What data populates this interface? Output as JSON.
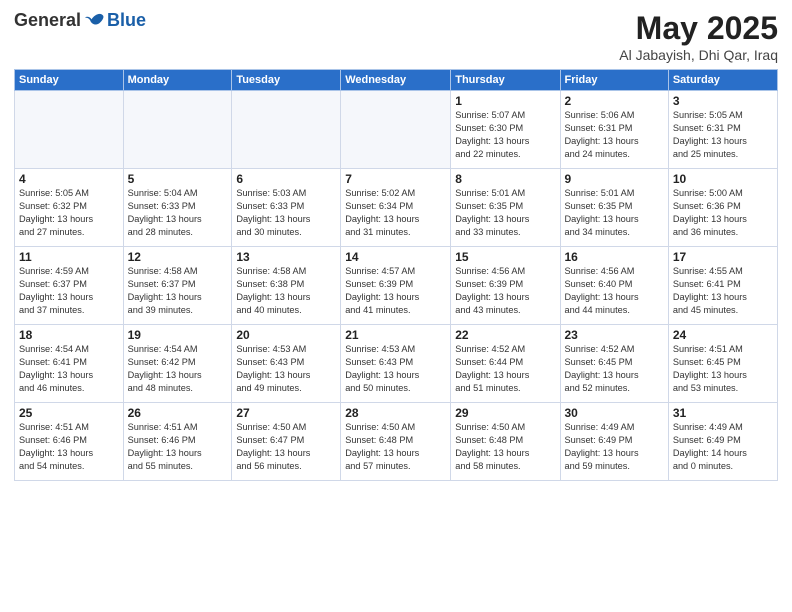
{
  "header": {
    "logo_general": "General",
    "logo_blue": "Blue",
    "month_title": "May 2025",
    "location": "Al Jabayish, Dhi Qar, Iraq"
  },
  "days_of_week": [
    "Sunday",
    "Monday",
    "Tuesday",
    "Wednesday",
    "Thursday",
    "Friday",
    "Saturday"
  ],
  "weeks": [
    [
      {
        "day": "",
        "info": ""
      },
      {
        "day": "",
        "info": ""
      },
      {
        "day": "",
        "info": ""
      },
      {
        "day": "",
        "info": ""
      },
      {
        "day": "1",
        "info": "Sunrise: 5:07 AM\nSunset: 6:30 PM\nDaylight: 13 hours\nand 22 minutes."
      },
      {
        "day": "2",
        "info": "Sunrise: 5:06 AM\nSunset: 6:31 PM\nDaylight: 13 hours\nand 24 minutes."
      },
      {
        "day": "3",
        "info": "Sunrise: 5:05 AM\nSunset: 6:31 PM\nDaylight: 13 hours\nand 25 minutes."
      }
    ],
    [
      {
        "day": "4",
        "info": "Sunrise: 5:05 AM\nSunset: 6:32 PM\nDaylight: 13 hours\nand 27 minutes."
      },
      {
        "day": "5",
        "info": "Sunrise: 5:04 AM\nSunset: 6:33 PM\nDaylight: 13 hours\nand 28 minutes."
      },
      {
        "day": "6",
        "info": "Sunrise: 5:03 AM\nSunset: 6:33 PM\nDaylight: 13 hours\nand 30 minutes."
      },
      {
        "day": "7",
        "info": "Sunrise: 5:02 AM\nSunset: 6:34 PM\nDaylight: 13 hours\nand 31 minutes."
      },
      {
        "day": "8",
        "info": "Sunrise: 5:01 AM\nSunset: 6:35 PM\nDaylight: 13 hours\nand 33 minutes."
      },
      {
        "day": "9",
        "info": "Sunrise: 5:01 AM\nSunset: 6:35 PM\nDaylight: 13 hours\nand 34 minutes."
      },
      {
        "day": "10",
        "info": "Sunrise: 5:00 AM\nSunset: 6:36 PM\nDaylight: 13 hours\nand 36 minutes."
      }
    ],
    [
      {
        "day": "11",
        "info": "Sunrise: 4:59 AM\nSunset: 6:37 PM\nDaylight: 13 hours\nand 37 minutes."
      },
      {
        "day": "12",
        "info": "Sunrise: 4:58 AM\nSunset: 6:37 PM\nDaylight: 13 hours\nand 39 minutes."
      },
      {
        "day": "13",
        "info": "Sunrise: 4:58 AM\nSunset: 6:38 PM\nDaylight: 13 hours\nand 40 minutes."
      },
      {
        "day": "14",
        "info": "Sunrise: 4:57 AM\nSunset: 6:39 PM\nDaylight: 13 hours\nand 41 minutes."
      },
      {
        "day": "15",
        "info": "Sunrise: 4:56 AM\nSunset: 6:39 PM\nDaylight: 13 hours\nand 43 minutes."
      },
      {
        "day": "16",
        "info": "Sunrise: 4:56 AM\nSunset: 6:40 PM\nDaylight: 13 hours\nand 44 minutes."
      },
      {
        "day": "17",
        "info": "Sunrise: 4:55 AM\nSunset: 6:41 PM\nDaylight: 13 hours\nand 45 minutes."
      }
    ],
    [
      {
        "day": "18",
        "info": "Sunrise: 4:54 AM\nSunset: 6:41 PM\nDaylight: 13 hours\nand 46 minutes."
      },
      {
        "day": "19",
        "info": "Sunrise: 4:54 AM\nSunset: 6:42 PM\nDaylight: 13 hours\nand 48 minutes."
      },
      {
        "day": "20",
        "info": "Sunrise: 4:53 AM\nSunset: 6:43 PM\nDaylight: 13 hours\nand 49 minutes."
      },
      {
        "day": "21",
        "info": "Sunrise: 4:53 AM\nSunset: 6:43 PM\nDaylight: 13 hours\nand 50 minutes."
      },
      {
        "day": "22",
        "info": "Sunrise: 4:52 AM\nSunset: 6:44 PM\nDaylight: 13 hours\nand 51 minutes."
      },
      {
        "day": "23",
        "info": "Sunrise: 4:52 AM\nSunset: 6:45 PM\nDaylight: 13 hours\nand 52 minutes."
      },
      {
        "day": "24",
        "info": "Sunrise: 4:51 AM\nSunset: 6:45 PM\nDaylight: 13 hours\nand 53 minutes."
      }
    ],
    [
      {
        "day": "25",
        "info": "Sunrise: 4:51 AM\nSunset: 6:46 PM\nDaylight: 13 hours\nand 54 minutes."
      },
      {
        "day": "26",
        "info": "Sunrise: 4:51 AM\nSunset: 6:46 PM\nDaylight: 13 hours\nand 55 minutes."
      },
      {
        "day": "27",
        "info": "Sunrise: 4:50 AM\nSunset: 6:47 PM\nDaylight: 13 hours\nand 56 minutes."
      },
      {
        "day": "28",
        "info": "Sunrise: 4:50 AM\nSunset: 6:48 PM\nDaylight: 13 hours\nand 57 minutes."
      },
      {
        "day": "29",
        "info": "Sunrise: 4:50 AM\nSunset: 6:48 PM\nDaylight: 13 hours\nand 58 minutes."
      },
      {
        "day": "30",
        "info": "Sunrise: 4:49 AM\nSunset: 6:49 PM\nDaylight: 13 hours\nand 59 minutes."
      },
      {
        "day": "31",
        "info": "Sunrise: 4:49 AM\nSunset: 6:49 PM\nDaylight: 14 hours\nand 0 minutes."
      }
    ]
  ]
}
